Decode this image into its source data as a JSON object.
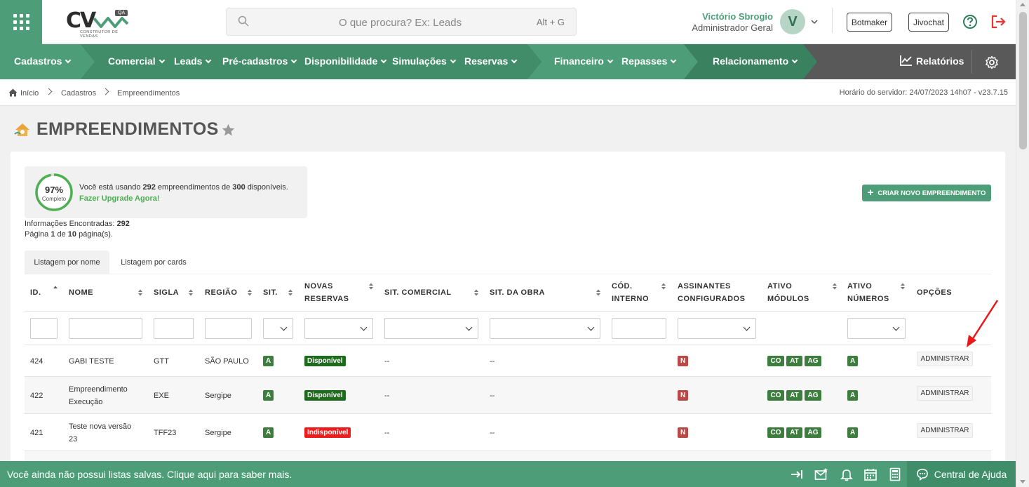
{
  "header": {
    "logo_text": "CV",
    "logo_badge": "QA",
    "logo_subtitle": "CONSTRUTOR DE VENDAS",
    "search_placeholder": "O que procura? Ex: Leads",
    "search_shortcut": "Alt + G",
    "user_name": "Victório Sbrogio",
    "user_role": "Administrador Geral",
    "avatar_letter": "V",
    "botmaker_label": "Botmaker",
    "jivochat_label": "Jivochat"
  },
  "nav": {
    "items": [
      {
        "label": "Cadastros"
      },
      {
        "label": "Comercial"
      },
      {
        "label": "Leads"
      },
      {
        "label": "Pré-cadastros"
      },
      {
        "label": "Disponibilidade"
      },
      {
        "label": "Simulações"
      },
      {
        "label": "Reservas"
      },
      {
        "label": "Financeiro"
      },
      {
        "label": "Repasses"
      },
      {
        "label": "Relacionamento"
      }
    ],
    "reports_label": "Relatórios",
    "colors": {
      "primary": "#4d9e78",
      "dark": "#3d8b67",
      "gray": "#595959"
    }
  },
  "breadcrumb": {
    "items": [
      "Início",
      "Cadastros",
      "Empreendimentos"
    ],
    "server_time": "Horário do servidor: 24/07/2023 14h07 - v23.7.15"
  },
  "page": {
    "title": "EMPREENDIMENTOS"
  },
  "usage": {
    "percent_label": "97%",
    "percent_value": 0.97,
    "complete_label": "Completo",
    "text_prefix": "Você está usando ",
    "used": "292",
    "text_mid": " empreendimentos de ",
    "total": "300",
    "text_suffix": " disponíveis.",
    "upgrade_label": "Fazer Upgrade Agora!"
  },
  "info": {
    "found_label": "Informações Encontradas: ",
    "found_value": "292",
    "page_prefix": "Página ",
    "page_current": "1",
    "page_mid": " de ",
    "page_total": "10",
    "page_suffix": " página(s)."
  },
  "create_button_label": "CRIAR NOVO EMPREENDIMENTO",
  "tabs": [
    {
      "label": "Listagem por nome",
      "active": true
    },
    {
      "label": "Listagem por cards",
      "active": false
    }
  ],
  "table": {
    "columns": {
      "id": "ID.",
      "nome": "NOME",
      "sigla": "SIGLA",
      "regiao": "REGIÃO",
      "sit": "SIT.",
      "novas_1": "NOVAS",
      "novas_2": "RESERVAS",
      "sit_comercial": "SIT. COMERCIAL",
      "sit_obra": "SIT. DA OBRA",
      "cod_1": "CÓD.",
      "cod_2": "INTERNO",
      "assin_1": "ASSINANTES",
      "assin_2": "CONFIGURADOS",
      "modulos_1": "ATIVO",
      "modulos_2": "MÓDULOS",
      "numeros_1": "ATIVO",
      "numeros_2": "NÚMEROS",
      "opcoes": "OPÇÕES"
    },
    "rows": [
      {
        "id": "424",
        "nome_1": "GABI TESTE",
        "nome_2": "",
        "sigla": "GTT",
        "regiao": "SÃO PAULO",
        "sit": "A",
        "novas": "Disponível",
        "sit_comercial": "--",
        "sit_obra": "--",
        "assin": "N",
        "mod_co": "CO",
        "mod_at": "AT",
        "mod_ag": "AG",
        "numeros": "A",
        "action": "ADMINISTRAR"
      },
      {
        "id": "422",
        "nome_1": "Empreendimento",
        "nome_2": "Execução",
        "sigla": "EXE",
        "regiao": "Sergipe",
        "sit": "A",
        "novas": "Disponível",
        "sit_comercial": "--",
        "sit_obra": "--",
        "assin": "N",
        "mod_co": "CO",
        "mod_at": "AT",
        "mod_ag": "AG",
        "numeros": "A",
        "action": "ADMINISTRAR"
      },
      {
        "id": "421",
        "nome_1": "Teste nova versão",
        "nome_2": "23",
        "sigla": "TFF23",
        "regiao": "Sergipe",
        "sit": "A",
        "novas": "Indisponível",
        "sit_comercial": "--",
        "sit_obra": "--",
        "assin": "N",
        "mod_co": "CO",
        "mod_at": "AT",
        "mod_ag": "AG",
        "numeros": "A",
        "action": "ADMINISTRAR"
      }
    ]
  },
  "bottom": {
    "message": "Você ainda não possui listas salvas. Clique aqui para saber mais.",
    "help_center_label": "Central de Ajuda"
  }
}
